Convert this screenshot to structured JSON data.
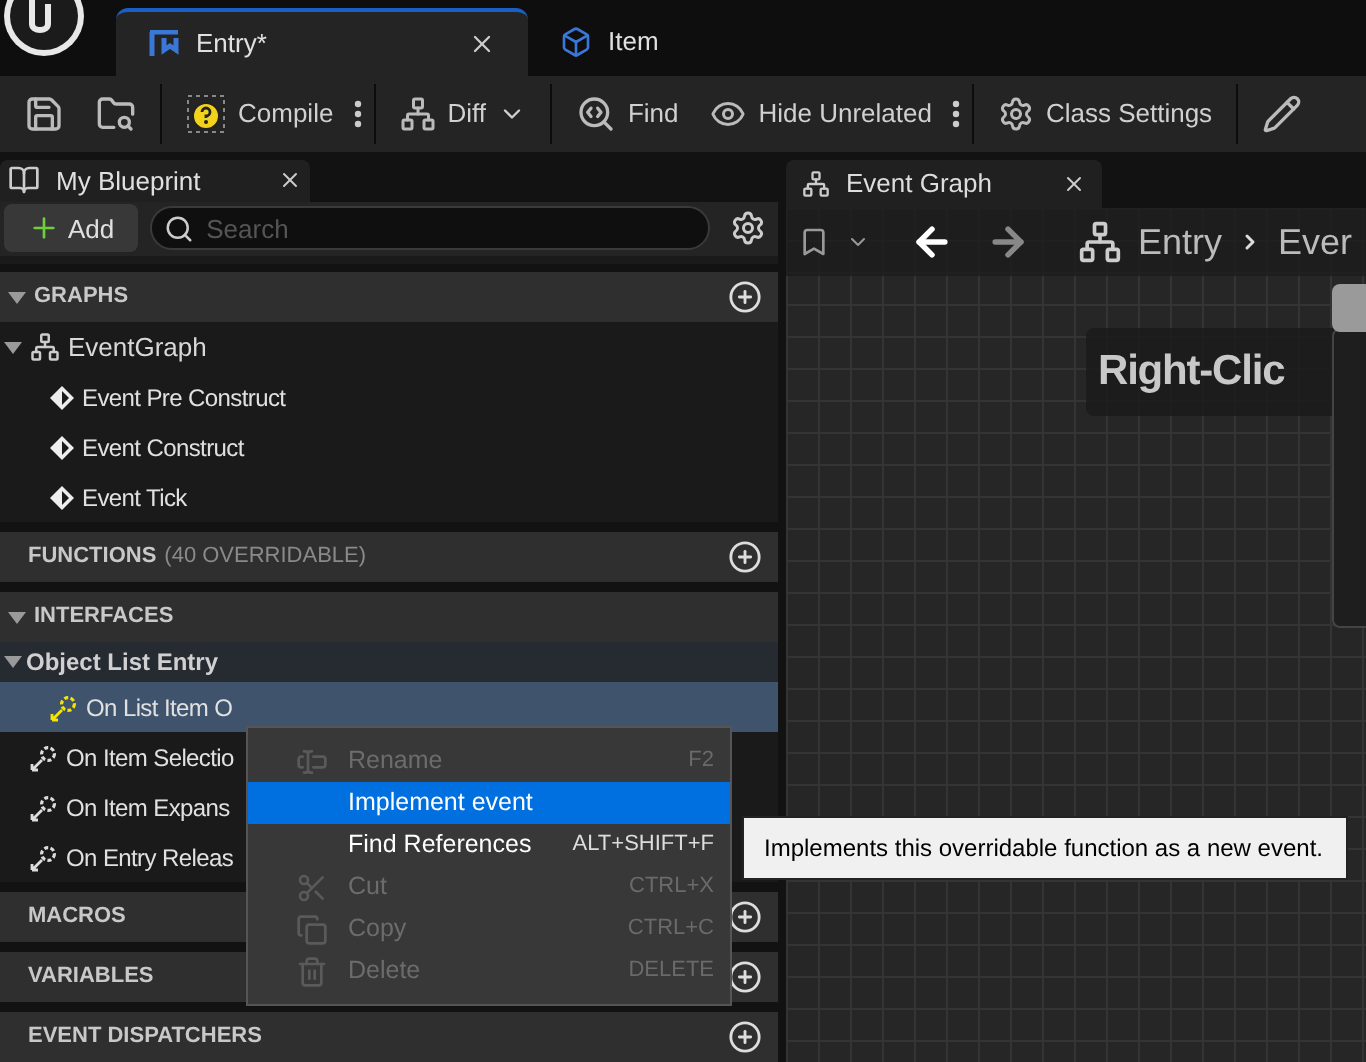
{
  "top_tabs": [
    {
      "label": "Entry*",
      "kind": "widget",
      "selected": true
    },
    {
      "label": "Item",
      "kind": "class",
      "selected": false
    }
  ],
  "toolbar": [
    {
      "kind": "save"
    },
    {
      "kind": "browse"
    },
    {
      "kind": "separator"
    },
    {
      "kind": "compile",
      "label": "Compile"
    },
    {
      "kind": "more"
    },
    {
      "kind": "separator"
    },
    {
      "kind": "diff",
      "label": "Diff"
    },
    {
      "kind": "separator"
    },
    {
      "kind": "find",
      "label": "Find"
    },
    {
      "kind": "hide",
      "label": "Hide Unrelated"
    },
    {
      "kind": "more"
    },
    {
      "kind": "separator"
    },
    {
      "kind": "settings",
      "label": "Class Settings"
    },
    {
      "kind": "separator"
    },
    {
      "kind": "edit"
    }
  ],
  "my_blueprint": {
    "tab": "My Blueprint",
    "add_button": "Add",
    "search": {
      "placeholder": "Search"
    },
    "sections": [
      {
        "title": "GRAPHS",
        "expanded": true,
        "add": true,
        "items": [
          {
            "label": "EventGraph",
            "kind": "graph",
            "expanded": true,
            "children": [
              {
                "label": "Event Pre Construct",
                "kind": "event"
              },
              {
                "label": "Event Construct",
                "kind": "event"
              },
              {
                "label": "Event Tick",
                "kind": "event"
              }
            ]
          }
        ]
      },
      {
        "title": "FUNCTIONS",
        "note": "(40 OVERRIDABLE)",
        "expanded": false,
        "add": true
      },
      {
        "title": "INTERFACES",
        "expanded": true,
        "add": false,
        "items": [
          {
            "label": "Object List Entry",
            "kind": "interface",
            "expanded": true,
            "children": [
              {
                "label": "On List Item O",
                "kind": "function",
                "selected": true
              },
              {
                "label": "On Item Selectio",
                "kind": "function",
                "selected": false
              },
              {
                "label": "On Item Expans",
                "kind": "function",
                "selected": false
              },
              {
                "label": "On Entry Releas",
                "kind": "function",
                "selected": false
              }
            ]
          }
        ]
      },
      {
        "title": "MACROS",
        "expanded": false,
        "add": true
      },
      {
        "title": "VARIABLES",
        "expanded": false,
        "add": true
      },
      {
        "title": "EVENT DISPATCHERS",
        "expanded": false,
        "add": true
      }
    ]
  },
  "graph": {
    "tab": "Event Graph",
    "breadcrumb": [
      "Entry",
      "Ever"
    ],
    "banner": "Right-Clic"
  },
  "context_menu": [
    {
      "label": "Rename",
      "shortcut": "F2",
      "kind": "rename",
      "disabled": true,
      "selected": false
    },
    {
      "label": "Implement event",
      "kind": "plain",
      "disabled": false,
      "selected": true
    },
    {
      "label": "Find References",
      "shortcut": "ALT+SHIFT+F",
      "kind": "plain",
      "disabled": false,
      "selected": false
    },
    {
      "label": "Cut",
      "shortcut": "CTRL+X",
      "kind": "cut",
      "disabled": true,
      "selected": false
    },
    {
      "label": "Copy",
      "shortcut": "CTRL+C",
      "kind": "copy",
      "disabled": true,
      "selected": false
    },
    {
      "label": "Delete",
      "shortcut": "DELETE",
      "kind": "delete",
      "disabled": true,
      "selected": false
    }
  ],
  "tooltip": "Implements this overridable function as a new event."
}
